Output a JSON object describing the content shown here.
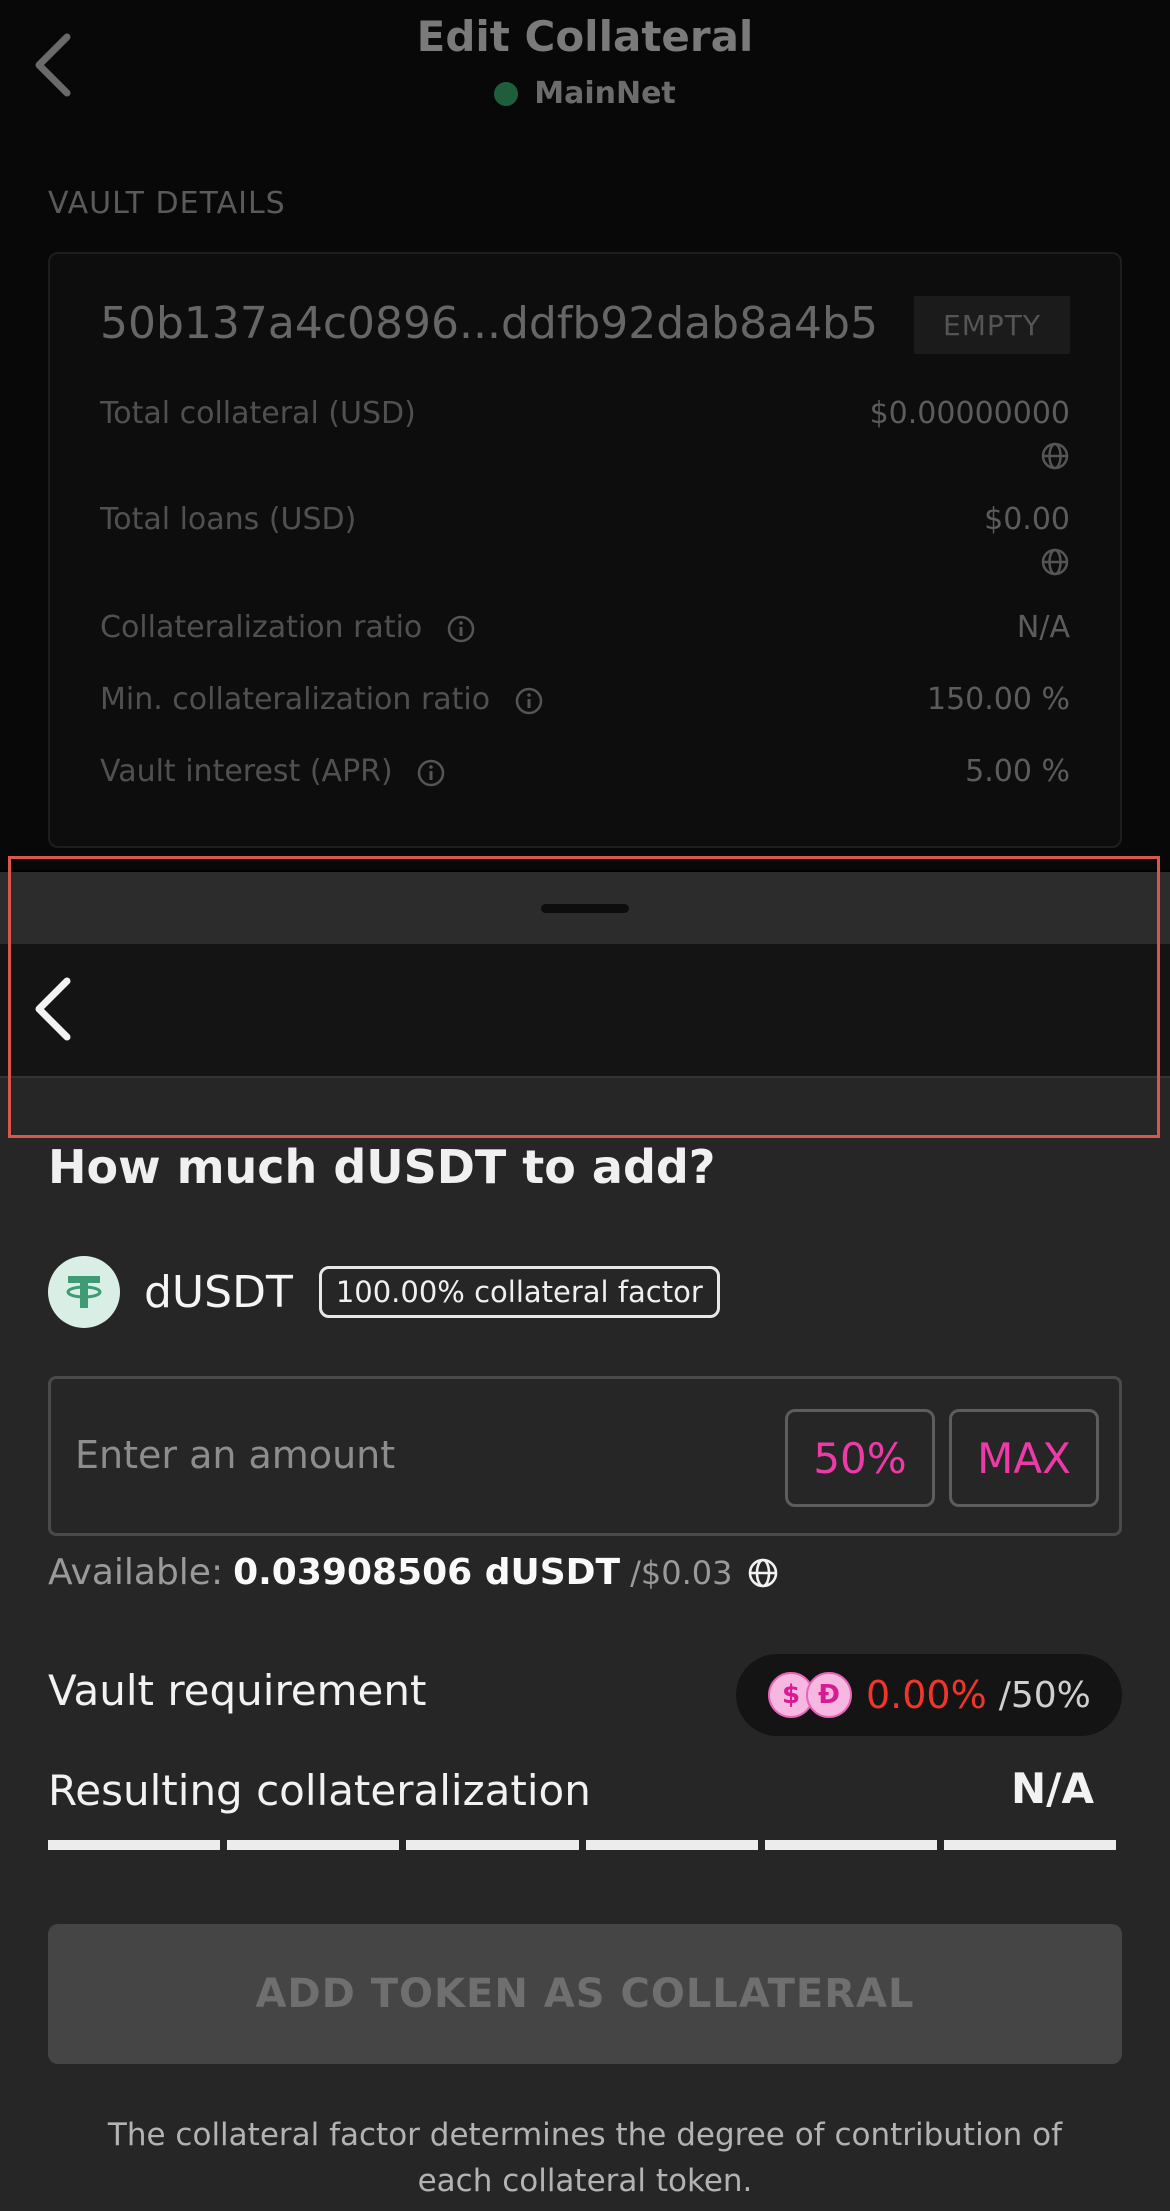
{
  "header": {
    "title": "Edit Collateral",
    "network": "MainNet"
  },
  "vault": {
    "section_label": "VAULT DETAILS",
    "id": "50b137a4c0896...ddfb92dab8a4b5",
    "status": "EMPTY",
    "rows": [
      {
        "label": "Total collateral (USD)",
        "value": "$0.00000000"
      },
      {
        "label": "Total loans (USD)",
        "value": "$0.00"
      },
      {
        "label": "Collateralization ratio",
        "value": "N/A"
      },
      {
        "label": "Min. collateralization ratio",
        "value": "150.00 %"
      },
      {
        "label": "Vault interest (APR)",
        "value": "5.00 %"
      }
    ]
  },
  "sheet": {
    "title": "How much dUSDT to add?",
    "token": {
      "name": "dUSDT",
      "factor": "100.00% collateral factor"
    },
    "amount": {
      "placeholder": "Enter an amount",
      "half_label": "50%",
      "max_label": "MAX"
    },
    "available": {
      "label": "Available:",
      "amount": "0.03908506 dUSDT",
      "usd": "/$0.03"
    },
    "requirement": {
      "label": "Vault requirement",
      "current": "0.00%",
      "target": "/50%"
    },
    "result": {
      "label": "Resulting collateralization",
      "value": "N/A"
    },
    "submit_label": "ADD TOKEN AS COLLATERAL",
    "footnote": "The collateral factor determines the degree of contribution of each collateral token."
  },
  "colors": {
    "accent": "#ee3aa8",
    "warning": "#f0362a",
    "network_dot": "#1f5e3a",
    "highlight": "#d8574a"
  },
  "icons": [
    "chevron-left-icon",
    "info-icon",
    "globe-icon",
    "tether-icon",
    "dusd-icon"
  ]
}
